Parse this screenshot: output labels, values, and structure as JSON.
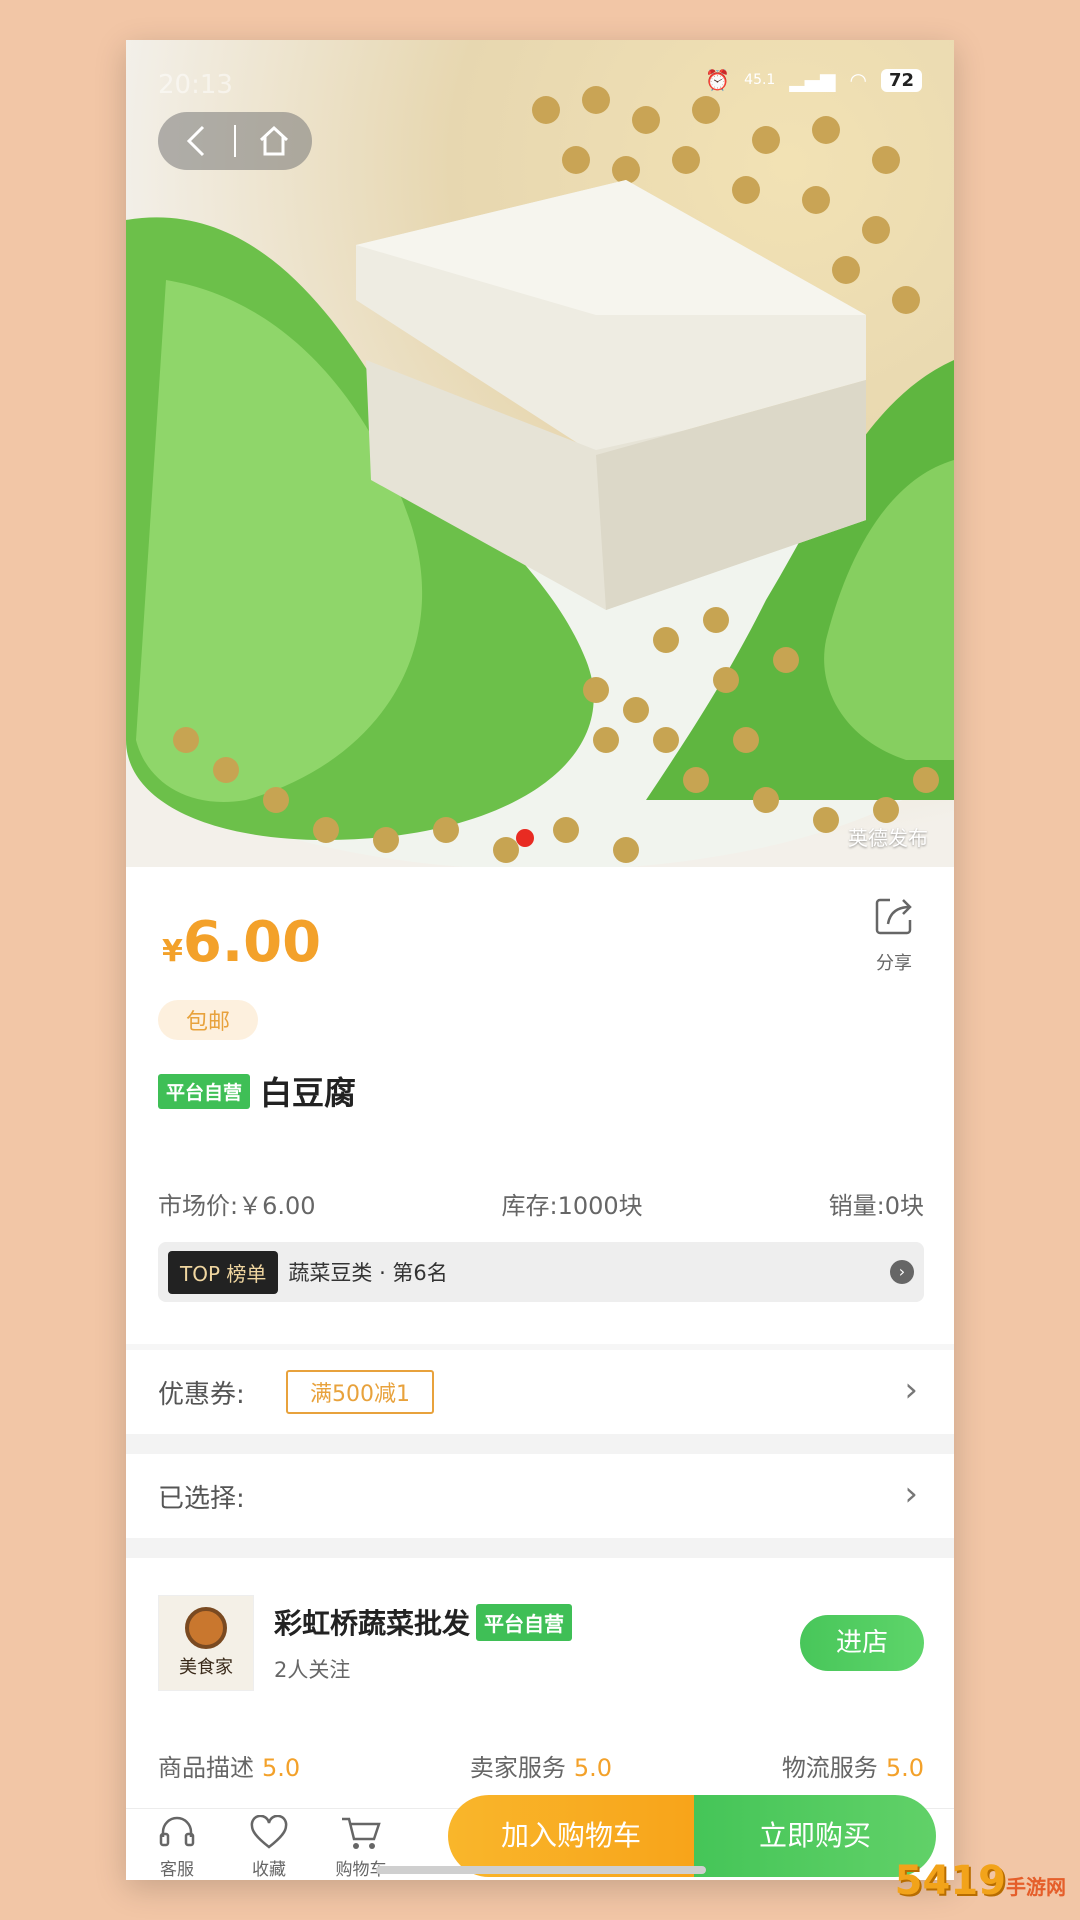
{
  "status": {
    "time": "20:13",
    "net_speed": "45.1",
    "battery": "72"
  },
  "image": {
    "watermark": "英德发布"
  },
  "product": {
    "currency": "¥",
    "price": "6.00",
    "share_label": "分享",
    "shipping_tag": "包邮",
    "self_badge": "平台自营",
    "name": "白豆腐",
    "market_price": "市场价:￥6.00",
    "stock": "库存:1000块",
    "sales": "销量:0块",
    "rank_top": "TOP 榜单",
    "rank_text": "蔬菜豆类 · 第6名"
  },
  "coupon": {
    "label": "优惠券:",
    "value": "满500减1"
  },
  "selected": {
    "label": "已选择:"
  },
  "shop": {
    "logo_text": "美食家",
    "name": "彩虹桥蔬菜批发",
    "badge": "平台自营",
    "followers": "2人关注",
    "enter_label": "进店",
    "ratings": [
      {
        "label": "商品描述",
        "value": "5.0"
      },
      {
        "label": "卖家服务",
        "value": "5.0"
      },
      {
        "label": "物流服务",
        "value": "5.0"
      }
    ]
  },
  "bottom_bar": {
    "service": "客服",
    "favorite": "收藏",
    "cart": "购物车",
    "add_cart": "加入购物车",
    "buy_now": "立即购买"
  },
  "site_watermark": {
    "main": "5419",
    "sub": "手游网"
  },
  "colors": {
    "accent_orange": "#f3a12a",
    "accent_green": "#45c558",
    "page_bg": "#f2c6a6"
  }
}
